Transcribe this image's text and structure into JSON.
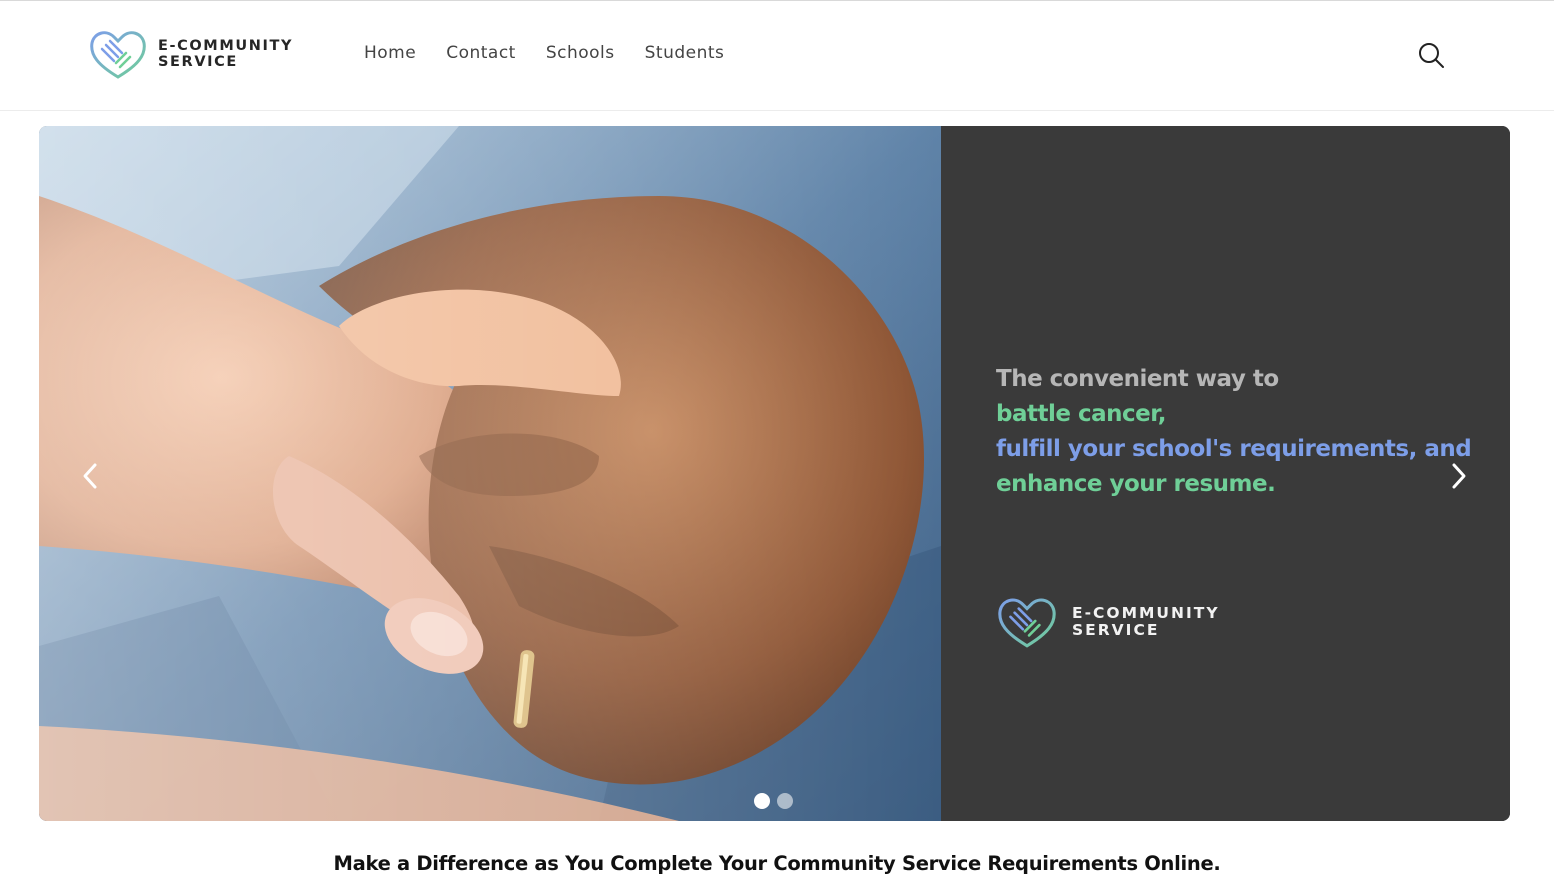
{
  "header": {
    "brand_line1": "E-COMMUNITY",
    "brand_line2": "SERVICE",
    "nav": [
      {
        "label": "Home"
      },
      {
        "label": "Contact"
      },
      {
        "label": "Schools"
      },
      {
        "label": "Students"
      }
    ],
    "search_icon": "search-icon"
  },
  "hero": {
    "tagline": {
      "line1": "The convenient way to",
      "line2": "battle cancer,",
      "line3": "fulfill your school's requirements, and",
      "line4": "enhance your resume."
    },
    "brand_line1": "E-COMMUNITY",
    "brand_line2": "SERVICE",
    "prev_icon": "chevron-left-icon",
    "next_icon": "chevron-right-icon",
    "slides_count": 2,
    "active_slide": 1,
    "colors": {
      "panel": "#3a3a3a",
      "tagline_grey": "#b6b6b6",
      "tagline_green": "#6fcf97",
      "tagline_blue": "#7d9ee8"
    }
  },
  "main": {
    "headline": "Make a Difference as You Complete Your Community Service Requirements Online."
  }
}
